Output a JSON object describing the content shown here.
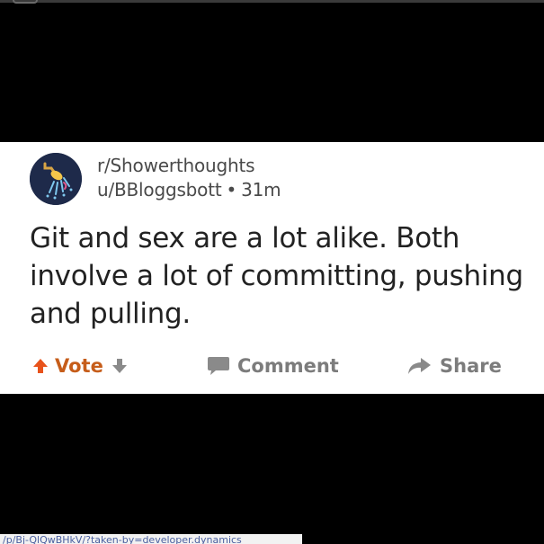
{
  "post": {
    "subreddit": "r/Showerthoughts",
    "author": "u/BBloggsbott",
    "separator": "•",
    "age": "31m",
    "title": "Git and sex are a lot alike. Both involve a lot of committing, pushing and pulling."
  },
  "actions": {
    "vote_label": "Vote",
    "comment_label": "Comment",
    "share_label": "Share"
  },
  "footer": {
    "url": "/p/Bj-QlQwBHkV/?taken-by=developer.dynamics"
  },
  "colors": {
    "card_background": "#ffffff",
    "page_background": "#000000",
    "upvote": "#e8531c",
    "vote_label": "#c65d1a",
    "muted": "#7c7c7c",
    "text": "#222222",
    "avatar_background": "#1e2a4a"
  },
  "icons": {
    "avatar": "shower-head-icon",
    "upvote": "up-arrow-icon",
    "downvote": "down-arrow-icon",
    "comment": "speech-bubble-icon",
    "share": "share-arrow-icon"
  }
}
